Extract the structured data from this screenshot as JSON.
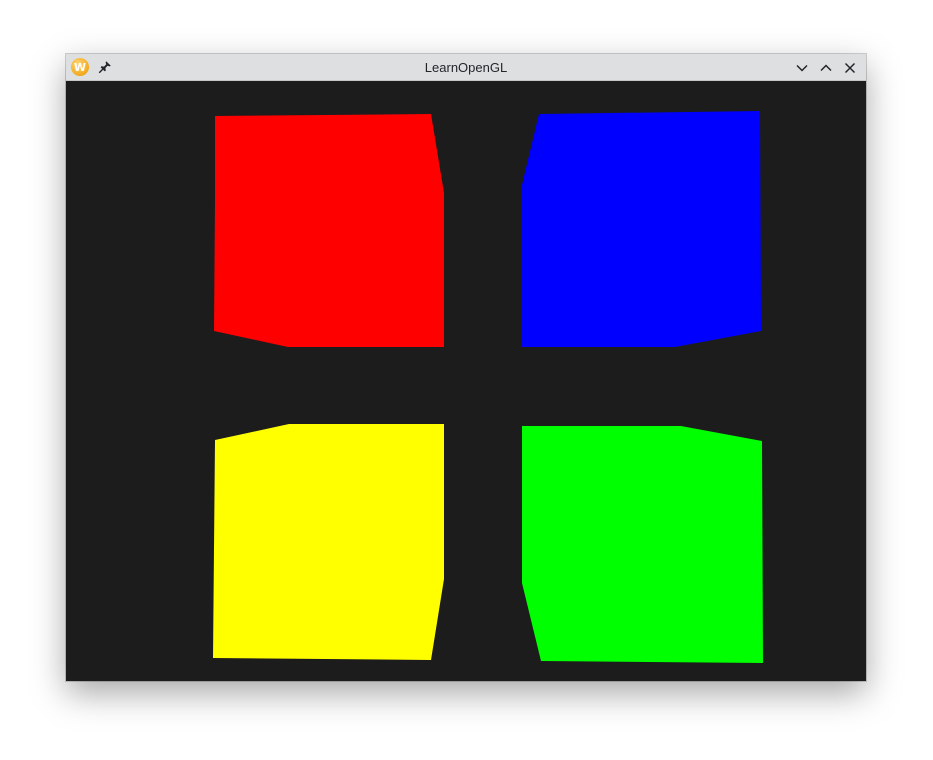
{
  "window": {
    "title": "LearnOpenGL",
    "icon": "app-logo-icon",
    "icon_glyph": "W",
    "buttons": [
      "pin-icon",
      "chevron-down-icon",
      "chevron-up-icon",
      "close-icon"
    ]
  },
  "scene": {
    "background_color": "#1c1c1c",
    "quads": [
      {
        "name": "red-quad",
        "color": "#ff0000"
      },
      {
        "name": "blue-quad",
        "color": "#0000ff"
      },
      {
        "name": "yellow-quad",
        "color": "#ffff00"
      },
      {
        "name": "green-quad",
        "color": "#00ff00"
      }
    ]
  }
}
